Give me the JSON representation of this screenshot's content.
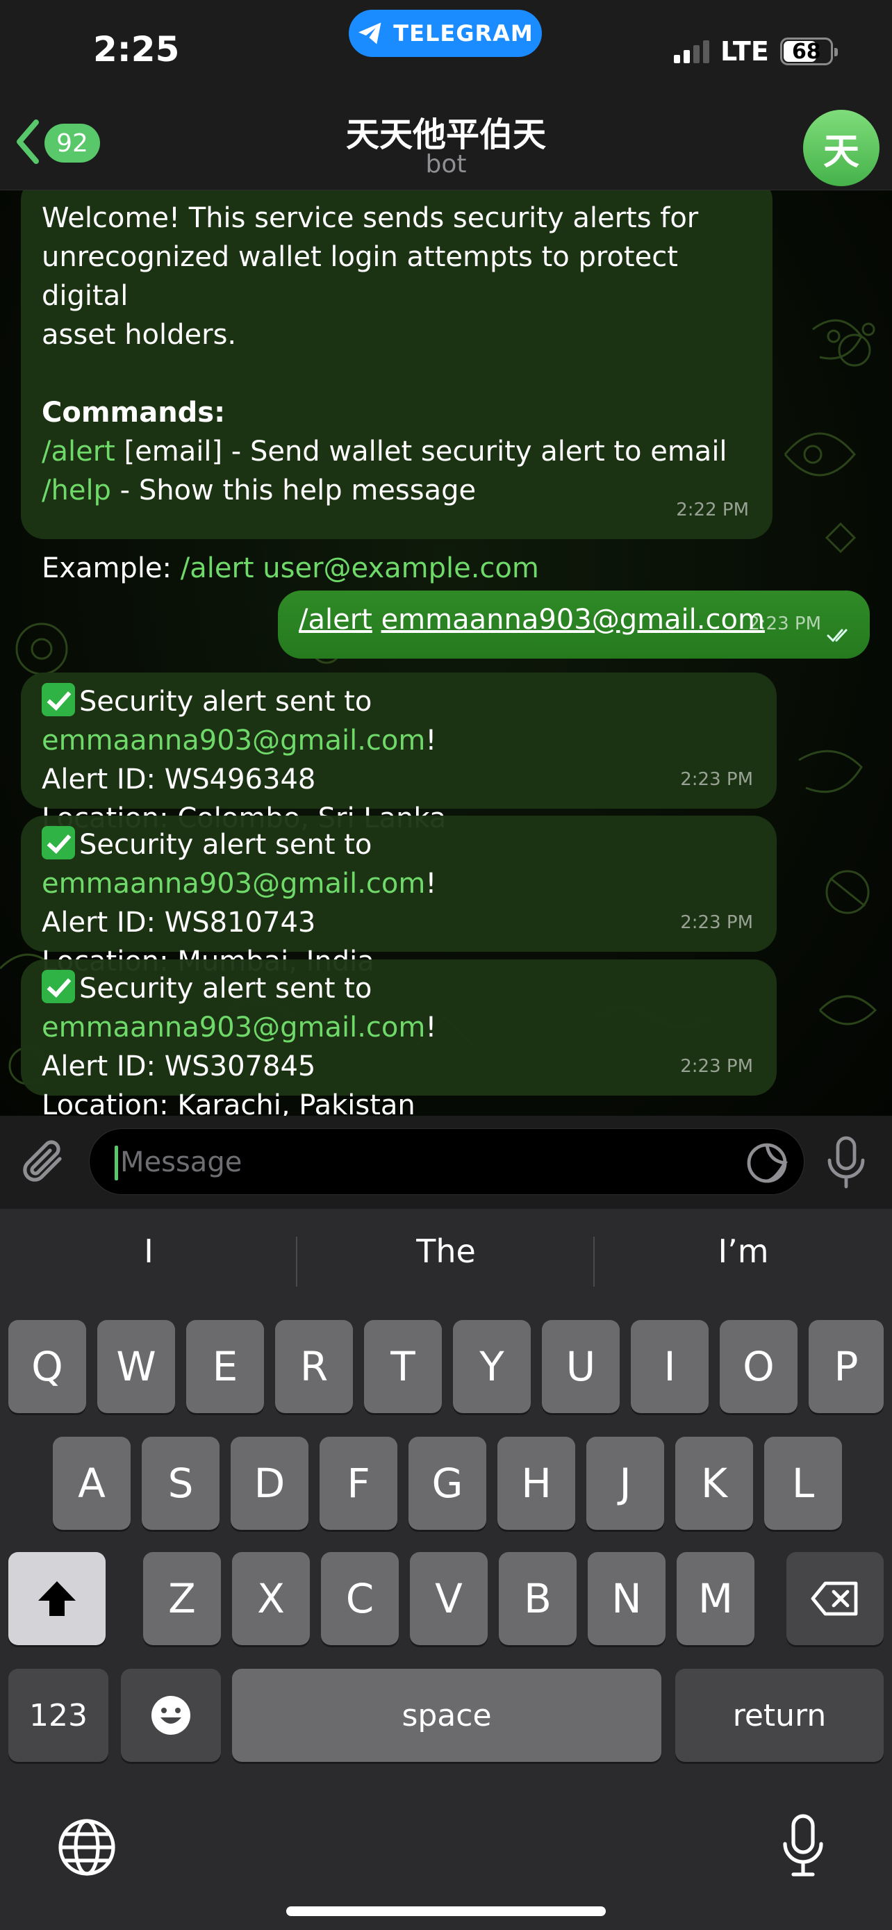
{
  "status_bar": {
    "time": "2:25",
    "app_pill": "TELEGRAM",
    "network": "LTE",
    "battery": "68"
  },
  "header": {
    "back_count": "92",
    "title": "天天他平伯天",
    "subtitle": "bot",
    "avatar_letter": "天"
  },
  "messages": {
    "welcome": {
      "line1": "Welcome! This service sends security alerts for",
      "line2": "unrecognized wallet login attempts to protect digital",
      "line3": "asset holders.",
      "commands_heading": "Commands:",
      "cmd_alert": "/alert",
      "cmd_alert_desc": " [email] - Send wallet security alert to email",
      "cmd_help": "/help",
      "cmd_help_desc": " - Show this help message",
      "example_label": "Example: ",
      "example_cmd": "/alert",
      "example_email": " user@example.com",
      "time": "2:22 PM"
    },
    "outgoing": {
      "cmd": "/alert",
      "email": "emmaanna903@gmail.com",
      "time": "2:23 PM"
    },
    "alerts": [
      {
        "prefix": "Security alert sent to ",
        "email": "emmaanna903@gmail.com",
        "suffix": "!",
        "alert_id": "Alert ID: WS496348",
        "location": "Location: Colombo, Sri Lanka",
        "time": "2:23 PM"
      },
      {
        "prefix": "Security alert sent to ",
        "email": "emmaanna903@gmail.com",
        "suffix": "!",
        "alert_id": "Alert ID: WS810743",
        "location": "Location: Mumbai, India",
        "time": "2:23 PM"
      },
      {
        "prefix": "Security alert sent to ",
        "email": "emmaanna903@gmail.com",
        "suffix": "!",
        "alert_id": "Alert ID: WS307845",
        "location": "Location: Karachi, Pakistan",
        "time": "2:23 PM"
      }
    ]
  },
  "input": {
    "placeholder": "Message"
  },
  "keyboard": {
    "suggestions": [
      "I",
      "The",
      "I’m"
    ],
    "row1": [
      "Q",
      "W",
      "E",
      "R",
      "T",
      "Y",
      "U",
      "I",
      "O",
      "P"
    ],
    "row2": [
      "A",
      "S",
      "D",
      "F",
      "G",
      "H",
      "J",
      "K",
      "L"
    ],
    "row3": [
      "Z",
      "X",
      "C",
      "V",
      "B",
      "N",
      "M"
    ],
    "numbers": "123",
    "space": "space",
    "return": "return"
  },
  "colors": {
    "accent_green": "#58c86a",
    "link_green": "#6fd96a",
    "telegram_blue": "#1a8cff"
  }
}
